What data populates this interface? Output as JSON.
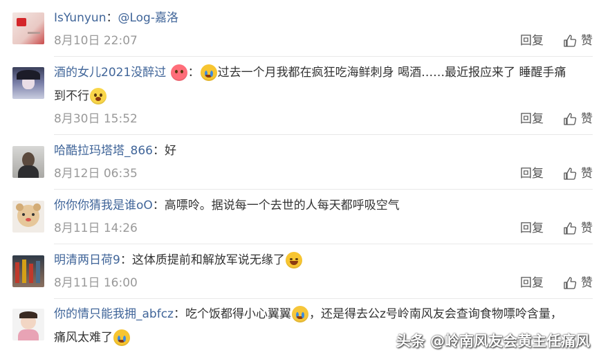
{
  "comments": [
    {
      "user": "IsYunyun",
      "sep": "：",
      "text": "@Log-嘉洛",
      "time": "8月10日 22:07",
      "reply": "回复",
      "like": "赞"
    },
    {
      "user": "酒的女儿2021没醉过",
      "sep": "：",
      "text": "过去一个月我都在疯狂吃海鲜刺身 喝酒……最近报应来了 睡醒手痛",
      "text2": "到不行",
      "time": "8月30日 15:52",
      "reply": "回复",
      "like": "赞"
    },
    {
      "user": "哈酷拉玛塔塔_866",
      "sep": "：",
      "text": "好",
      "time": "8月12日 06:35",
      "reply": "回复",
      "like": "赞"
    },
    {
      "user": "你你你猜我是谁oO",
      "sep": "：",
      "text": "高嘌呤。据说每一个去世的人每天都呼吸空气",
      "time": "8月11日 14:26",
      "reply": "回复",
      "like": "赞"
    },
    {
      "user": "明清两日荷9",
      "sep": "：",
      "text": "这体质提前和解放军说无缘了",
      "time": "8月11日 16:00",
      "reply": "回复",
      "like": "赞"
    },
    {
      "user": "你的情只能我拥_abfcz",
      "sep": "：",
      "text": "吃个饭都得小心翼翼",
      "text_b": "，还是得去公z号岭南风友会查询食物嘌呤含量，",
      "text2": "痛风太难了",
      "reply": "",
      "like": ""
    }
  ],
  "watermark": "头条 @岭南风友会黄主任痛风",
  "colors": {
    "username": "#406599",
    "meta": "#999999",
    "divider": "#e8e8e8"
  }
}
